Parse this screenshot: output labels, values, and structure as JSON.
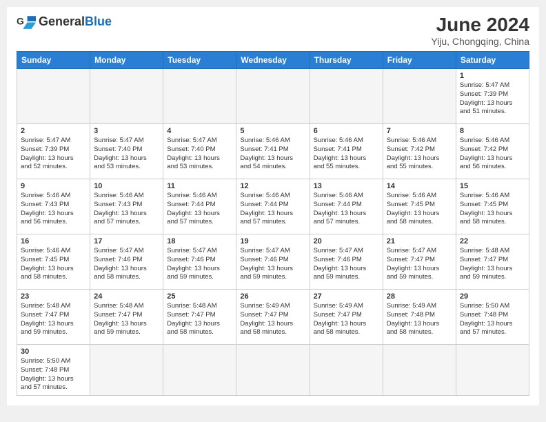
{
  "header": {
    "logo_general": "General",
    "logo_blue": "Blue",
    "title": "June 2024",
    "location": "Yiju, Chongqing, China"
  },
  "weekdays": [
    "Sunday",
    "Monday",
    "Tuesday",
    "Wednesday",
    "Thursday",
    "Friday",
    "Saturday"
  ],
  "weeks": [
    {
      "days": [
        {
          "num": "",
          "detail": "",
          "empty": true
        },
        {
          "num": "",
          "detail": "",
          "empty": true
        },
        {
          "num": "",
          "detail": "",
          "empty": true
        },
        {
          "num": "",
          "detail": "",
          "empty": true
        },
        {
          "num": "",
          "detail": "",
          "empty": true
        },
        {
          "num": "",
          "detail": "",
          "empty": true
        },
        {
          "num": "1",
          "detail": "Sunrise: 5:47 AM\nSunset: 7:39 PM\nDaylight: 13 hours\nand 51 minutes.",
          "empty": false
        }
      ]
    },
    {
      "days": [
        {
          "num": "2",
          "detail": "Sunrise: 5:47 AM\nSunset: 7:39 PM\nDaylight: 13 hours\nand 52 minutes.",
          "empty": false
        },
        {
          "num": "3",
          "detail": "Sunrise: 5:47 AM\nSunset: 7:40 PM\nDaylight: 13 hours\nand 53 minutes.",
          "empty": false
        },
        {
          "num": "4",
          "detail": "Sunrise: 5:47 AM\nSunset: 7:40 PM\nDaylight: 13 hours\nand 53 minutes.",
          "empty": false
        },
        {
          "num": "5",
          "detail": "Sunrise: 5:46 AM\nSunset: 7:41 PM\nDaylight: 13 hours\nand 54 minutes.",
          "empty": false
        },
        {
          "num": "6",
          "detail": "Sunrise: 5:46 AM\nSunset: 7:41 PM\nDaylight: 13 hours\nand 55 minutes.",
          "empty": false
        },
        {
          "num": "7",
          "detail": "Sunrise: 5:46 AM\nSunset: 7:42 PM\nDaylight: 13 hours\nand 55 minutes.",
          "empty": false
        },
        {
          "num": "8",
          "detail": "Sunrise: 5:46 AM\nSunset: 7:42 PM\nDaylight: 13 hours\nand 56 minutes.",
          "empty": false
        }
      ]
    },
    {
      "days": [
        {
          "num": "9",
          "detail": "Sunrise: 5:46 AM\nSunset: 7:43 PM\nDaylight: 13 hours\nand 56 minutes.",
          "empty": false
        },
        {
          "num": "10",
          "detail": "Sunrise: 5:46 AM\nSunset: 7:43 PM\nDaylight: 13 hours\nand 57 minutes.",
          "empty": false
        },
        {
          "num": "11",
          "detail": "Sunrise: 5:46 AM\nSunset: 7:44 PM\nDaylight: 13 hours\nand 57 minutes.",
          "empty": false
        },
        {
          "num": "12",
          "detail": "Sunrise: 5:46 AM\nSunset: 7:44 PM\nDaylight: 13 hours\nand 57 minutes.",
          "empty": false
        },
        {
          "num": "13",
          "detail": "Sunrise: 5:46 AM\nSunset: 7:44 PM\nDaylight: 13 hours\nand 57 minutes.",
          "empty": false
        },
        {
          "num": "14",
          "detail": "Sunrise: 5:46 AM\nSunset: 7:45 PM\nDaylight: 13 hours\nand 58 minutes.",
          "empty": false
        },
        {
          "num": "15",
          "detail": "Sunrise: 5:46 AM\nSunset: 7:45 PM\nDaylight: 13 hours\nand 58 minutes.",
          "empty": false
        }
      ]
    },
    {
      "days": [
        {
          "num": "16",
          "detail": "Sunrise: 5:46 AM\nSunset: 7:45 PM\nDaylight: 13 hours\nand 58 minutes.",
          "empty": false
        },
        {
          "num": "17",
          "detail": "Sunrise: 5:47 AM\nSunset: 7:46 PM\nDaylight: 13 hours\nand 58 minutes.",
          "empty": false
        },
        {
          "num": "18",
          "detail": "Sunrise: 5:47 AM\nSunset: 7:46 PM\nDaylight: 13 hours\nand 59 minutes.",
          "empty": false
        },
        {
          "num": "19",
          "detail": "Sunrise: 5:47 AM\nSunset: 7:46 PM\nDaylight: 13 hours\nand 59 minutes.",
          "empty": false
        },
        {
          "num": "20",
          "detail": "Sunrise: 5:47 AM\nSunset: 7:46 PM\nDaylight: 13 hours\nand 59 minutes.",
          "empty": false
        },
        {
          "num": "21",
          "detail": "Sunrise: 5:47 AM\nSunset: 7:47 PM\nDaylight: 13 hours\nand 59 minutes.",
          "empty": false
        },
        {
          "num": "22",
          "detail": "Sunrise: 5:48 AM\nSunset: 7:47 PM\nDaylight: 13 hours\nand 59 minutes.",
          "empty": false
        }
      ]
    },
    {
      "days": [
        {
          "num": "23",
          "detail": "Sunrise: 5:48 AM\nSunset: 7:47 PM\nDaylight: 13 hours\nand 59 minutes.",
          "empty": false
        },
        {
          "num": "24",
          "detail": "Sunrise: 5:48 AM\nSunset: 7:47 PM\nDaylight: 13 hours\nand 59 minutes.",
          "empty": false
        },
        {
          "num": "25",
          "detail": "Sunrise: 5:48 AM\nSunset: 7:47 PM\nDaylight: 13 hours\nand 58 minutes.",
          "empty": false
        },
        {
          "num": "26",
          "detail": "Sunrise: 5:49 AM\nSunset: 7:47 PM\nDaylight: 13 hours\nand 58 minutes.",
          "empty": false
        },
        {
          "num": "27",
          "detail": "Sunrise: 5:49 AM\nSunset: 7:47 PM\nDaylight: 13 hours\nand 58 minutes.",
          "empty": false
        },
        {
          "num": "28",
          "detail": "Sunrise: 5:49 AM\nSunset: 7:48 PM\nDaylight: 13 hours\nand 58 minutes.",
          "empty": false
        },
        {
          "num": "29",
          "detail": "Sunrise: 5:50 AM\nSunset: 7:48 PM\nDaylight: 13 hours\nand 57 minutes.",
          "empty": false
        }
      ]
    },
    {
      "days": [
        {
          "num": "30",
          "detail": "Sunrise: 5:50 AM\nSunset: 7:48 PM\nDaylight: 13 hours\nand 57 minutes.",
          "empty": false
        },
        {
          "num": "",
          "detail": "",
          "empty": true
        },
        {
          "num": "",
          "detail": "",
          "empty": true
        },
        {
          "num": "",
          "detail": "",
          "empty": true
        },
        {
          "num": "",
          "detail": "",
          "empty": true
        },
        {
          "num": "",
          "detail": "",
          "empty": true
        },
        {
          "num": "",
          "detail": "",
          "empty": true
        }
      ]
    }
  ],
  "colors": {
    "header_bg": "#2a7fd4",
    "logo_blue": "#1a6fb5"
  }
}
